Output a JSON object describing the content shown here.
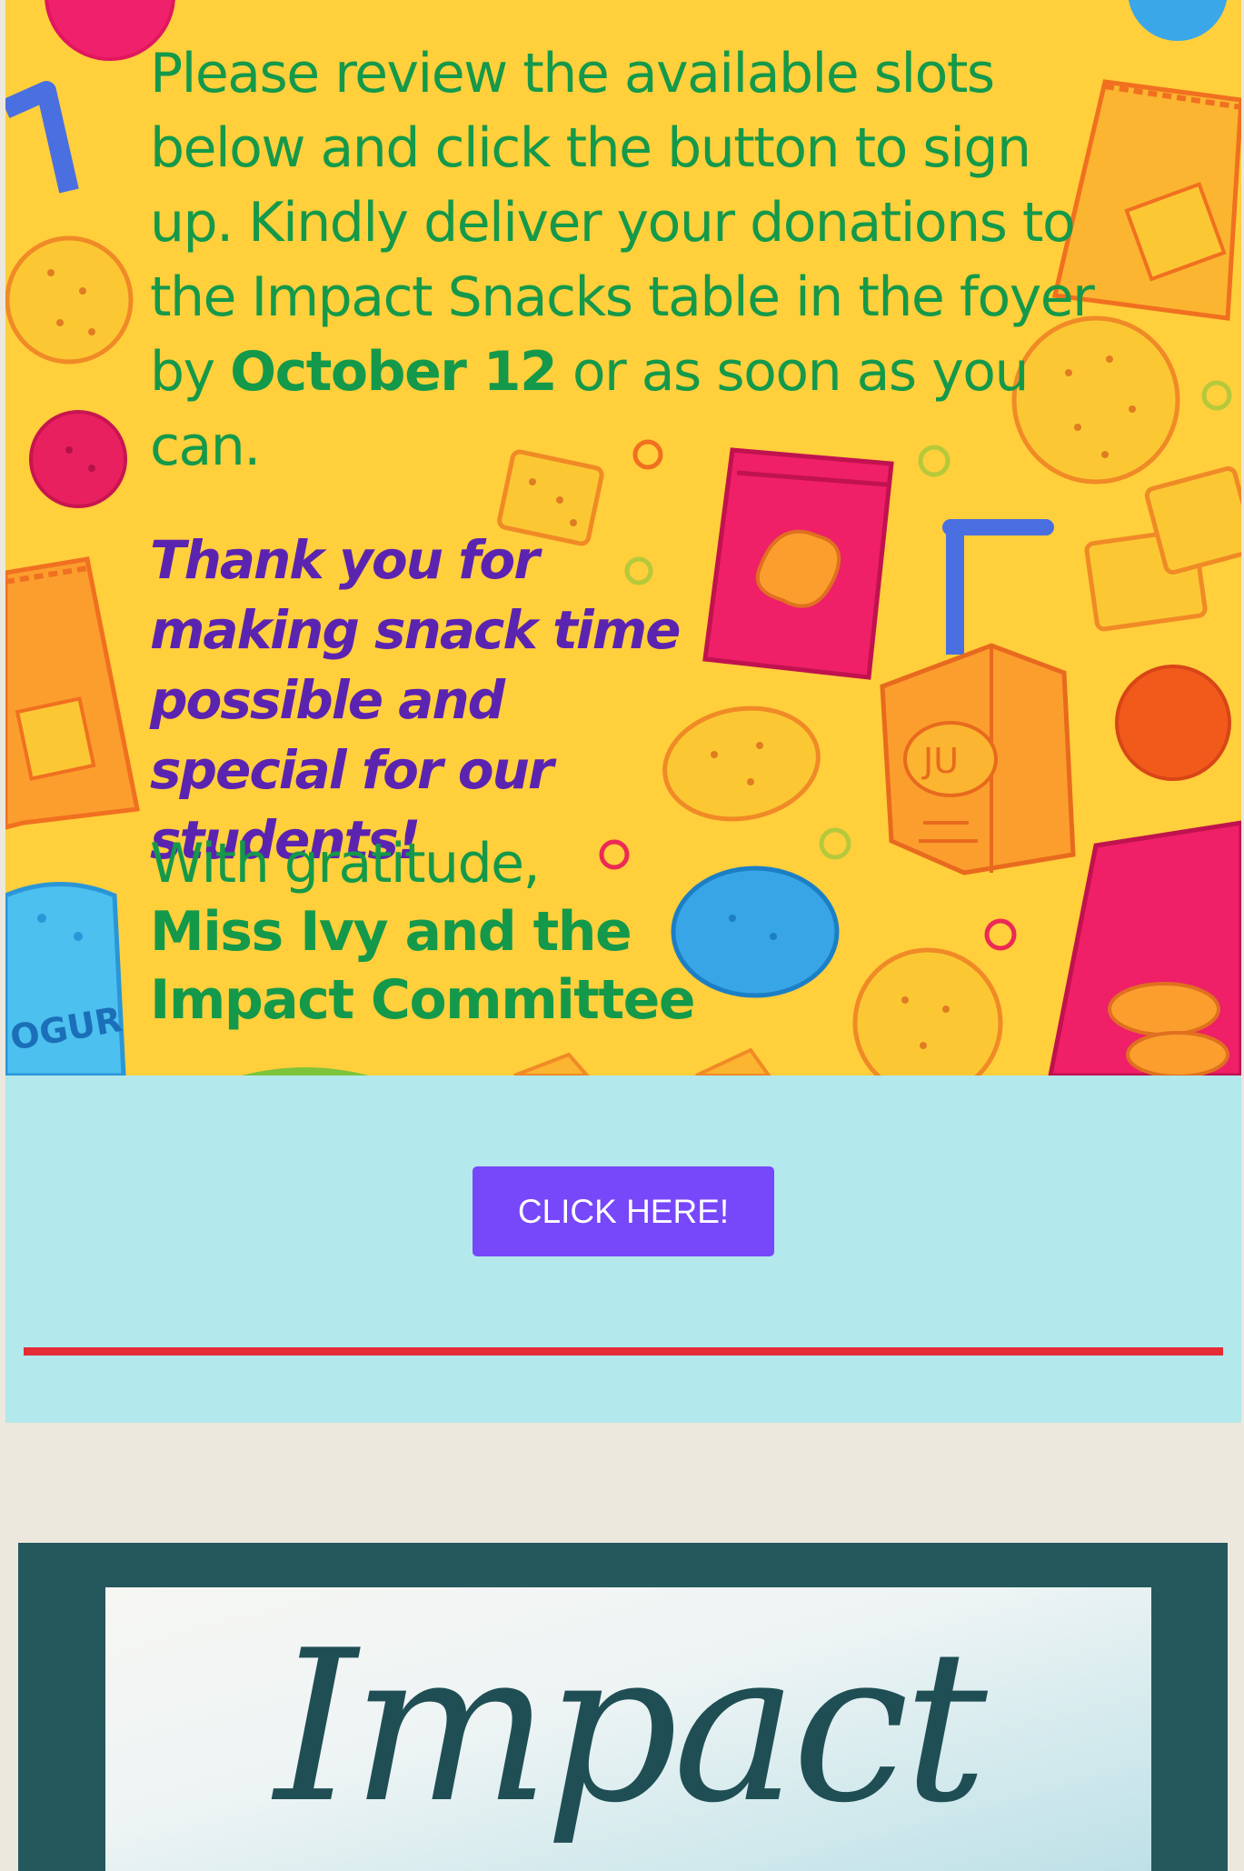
{
  "flyer": {
    "body_part1": "Please review the available slots below and click the button to sign up. Kindly deliver your donations to the Impact Snacks table in the foyer by ",
    "body_date": "October 12",
    "body_part2": " or as soon as you can.",
    "thanks": "Thank you for making snack time possible and special for our students!",
    "closing": "With gratitude,",
    "signature_line1": "Miss Ivy and the",
    "signature_line2": "Impact Committee",
    "juice_box_label": "JU",
    "yogurt_label": "OGUR"
  },
  "cta": {
    "button_label": "CLICK HERE!"
  },
  "banner": {
    "word": "Impact"
  },
  "colors": {
    "flyer_background": "#ffcf3c",
    "body_text": "#14994a",
    "thanks_text": "#5b24b0",
    "cta_band": "#b3e8ec",
    "button": "#7747fa",
    "divider": "#e52b36",
    "page_background": "#ede8dd",
    "banner_frame": "#25585c"
  }
}
